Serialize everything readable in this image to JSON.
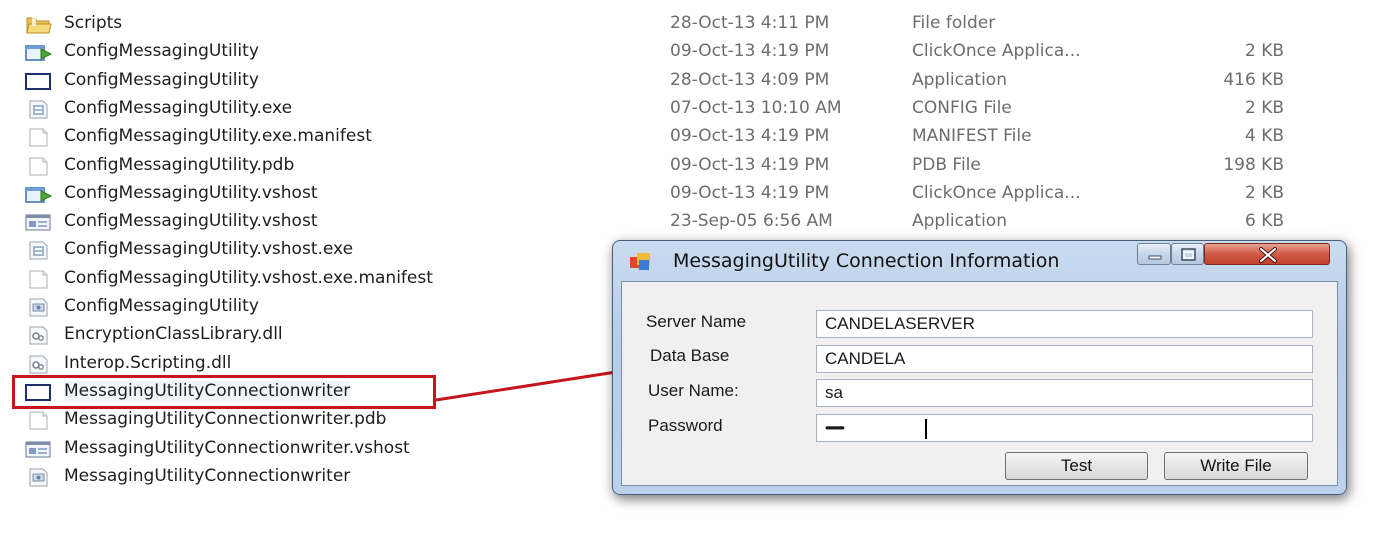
{
  "explorer": {
    "files": [
      {
        "name": "Scripts",
        "date": "28-Oct-13 4:11 PM",
        "type": "File folder",
        "size": "",
        "icon": "folder-icon"
      },
      {
        "name": "ConfigMessagingUtility",
        "date": "09-Oct-13 4:19 PM",
        "type": "ClickOnce Applica...",
        "size": "2 KB",
        "icon": "clickonce-icon"
      },
      {
        "name": "ConfigMessagingUtility",
        "date": "28-Oct-13 4:09 PM",
        "type": "Application",
        "size": "416 KB",
        "icon": "application-icon"
      },
      {
        "name": "ConfigMessagingUtility.exe",
        "date": "07-Oct-13 10:10 AM",
        "type": "CONFIG File",
        "size": "2 KB",
        "icon": "config-file-icon"
      },
      {
        "name": "ConfigMessagingUtility.exe.manifest",
        "date": "09-Oct-13 4:19 PM",
        "type": "MANIFEST File",
        "size": "4 KB",
        "icon": "blank-file-icon"
      },
      {
        "name": "ConfigMessagingUtility.pdb",
        "date": "09-Oct-13 4:19 PM",
        "type": "PDB File",
        "size": "198 KB",
        "icon": "blank-file-icon"
      },
      {
        "name": "ConfigMessagingUtility.vshost",
        "date": "09-Oct-13 4:19 PM",
        "type": "ClickOnce Applica...",
        "size": "2 KB",
        "icon": "clickonce-icon"
      },
      {
        "name": "ConfigMessagingUtility.vshost",
        "date": "23-Sep-05 6:56 AM",
        "type": "Application",
        "size": "6 KB",
        "icon": "vshost-app-icon"
      },
      {
        "name": "ConfigMessagingUtility.vshost.exe",
        "icon": "config-file-icon"
      },
      {
        "name": "ConfigMessagingUtility.vshost.exe.manifest",
        "icon": "blank-file-icon"
      },
      {
        "name": "ConfigMessagingUtility",
        "icon": "setup-file-icon"
      },
      {
        "name": "EncryptionClassLibrary.dll",
        "icon": "dll-icon"
      },
      {
        "name": "Interop.Scripting.dll",
        "icon": "dll-icon"
      },
      {
        "name": "MessagingUtilityConnectionwriter",
        "icon": "application-icon",
        "selected": true
      },
      {
        "name": "MessagingUtilityConnectionwriter.pdb",
        "icon": "blank-file-icon"
      },
      {
        "name": "MessagingUtilityConnectionwriter.vshost",
        "icon": "vshost-app-icon"
      },
      {
        "name": "MessagingUtilityConnectionwriter",
        "icon": "setup-file-icon"
      }
    ]
  },
  "annotation": {
    "highlight_color": "#c4161c",
    "arrow_color": "#c4161c"
  },
  "dialog": {
    "title": "MessagingUtility Connection Information",
    "fields": {
      "server_label": "Server Name",
      "server_value": "CANDELASERVER",
      "database_label": "Data Base",
      "database_value": "CANDELA",
      "user_label": "User Name:",
      "user_value": "sa",
      "password_label": "Password",
      "password_value": "••••••••••••••"
    },
    "buttons": {
      "test": "Test",
      "write_file": "Write File"
    }
  }
}
